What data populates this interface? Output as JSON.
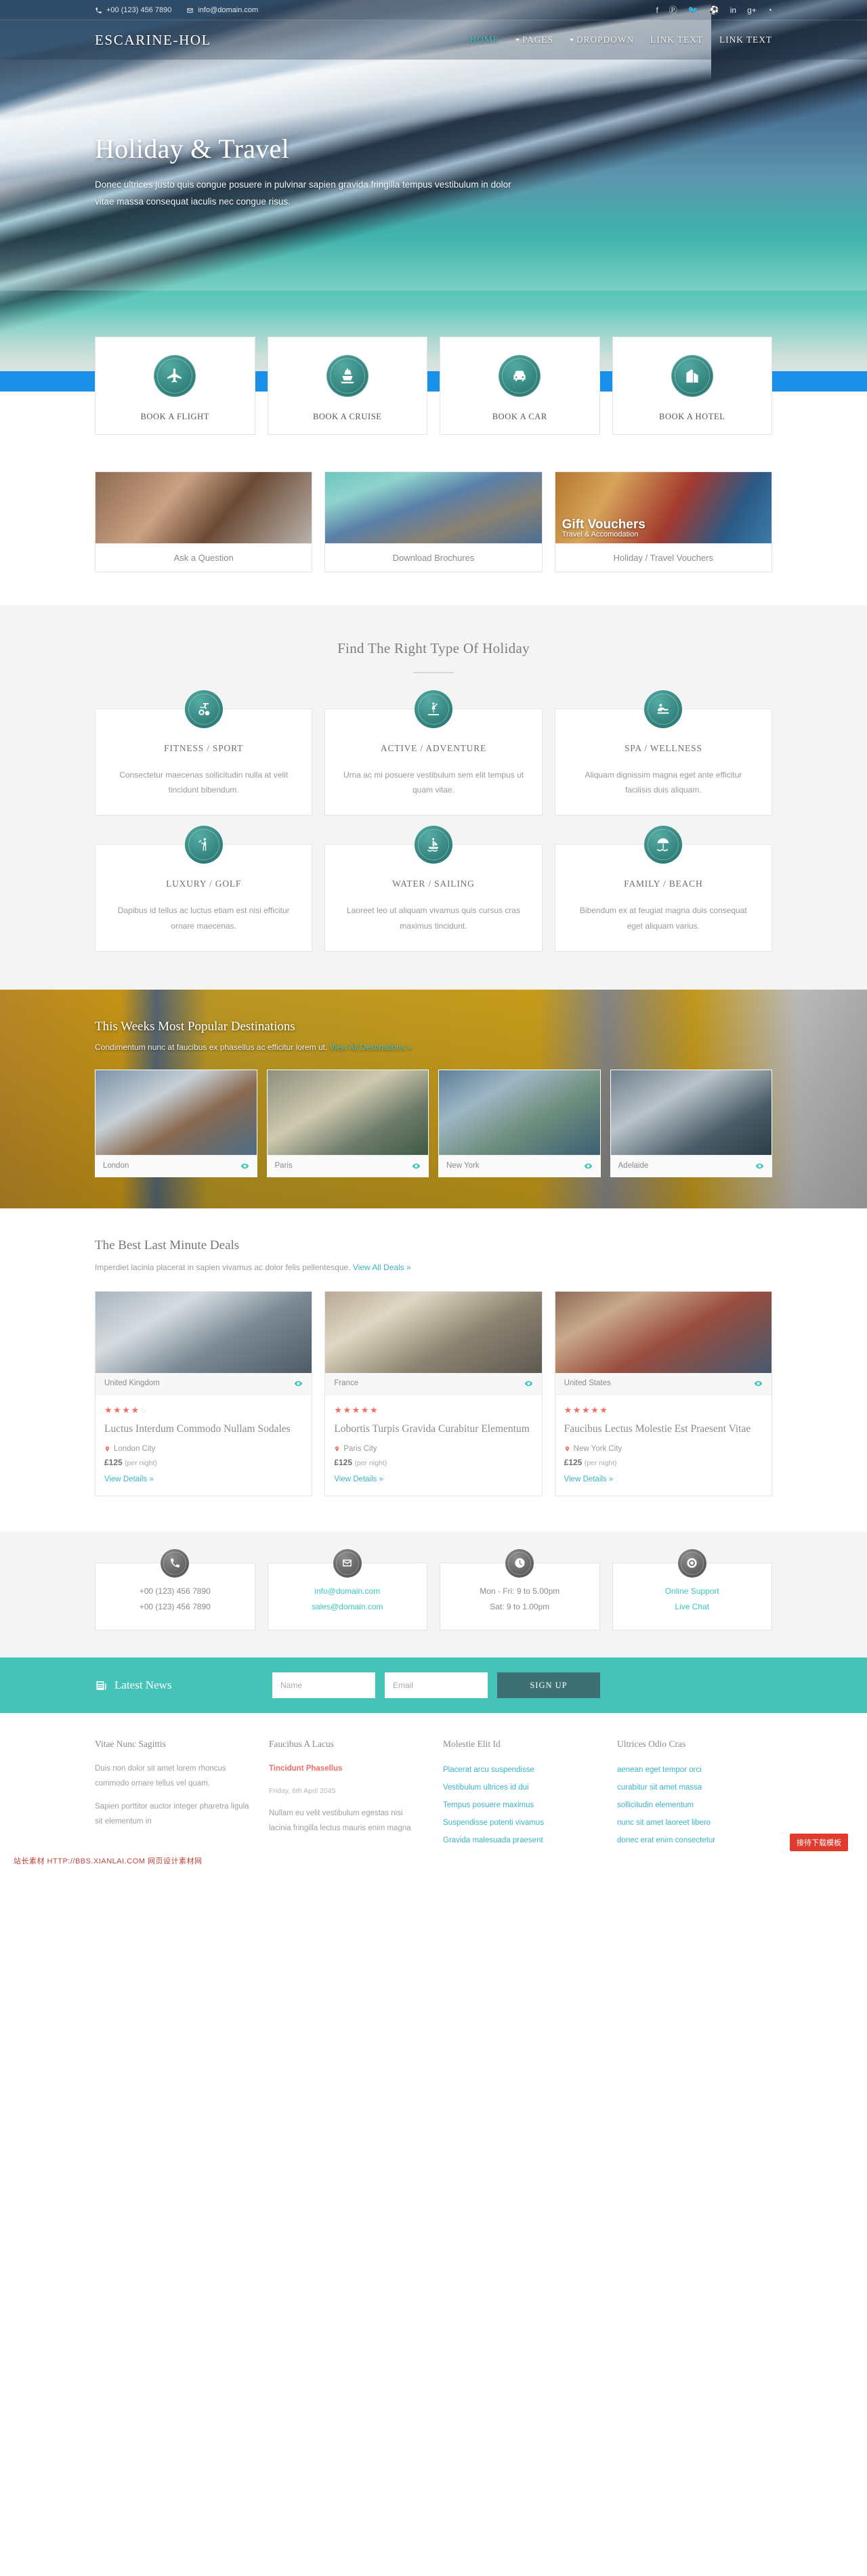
{
  "topbar": {
    "phone": "+00 (123) 456 7890",
    "email": "info@domain.com",
    "socials": [
      {
        "name": "facebook-icon",
        "glyph": "f"
      },
      {
        "name": "pinterest-icon",
        "glyph": "Ⓟ"
      },
      {
        "name": "twitter-icon",
        "glyph": "🐦"
      },
      {
        "name": "dribbble-icon",
        "glyph": "⚽"
      },
      {
        "name": "linkedin-icon",
        "glyph": "in"
      },
      {
        "name": "googleplus-icon",
        "glyph": "g+"
      },
      {
        "name": "rss-icon",
        "glyph": "◔"
      }
    ]
  },
  "header": {
    "logo": "ESCARINE-HOL",
    "nav": [
      {
        "label": "HOME",
        "active": true,
        "dropdown": false
      },
      {
        "label": "PAGES",
        "active": false,
        "dropdown": true
      },
      {
        "label": "DROPDOWN",
        "active": false,
        "dropdown": true
      },
      {
        "label": "LINK TEXT",
        "active": false,
        "dropdown": false
      },
      {
        "label": "LINK TEXT",
        "active": false,
        "dropdown": false
      }
    ]
  },
  "hero": {
    "title": "Holiday & Travel",
    "subtitle": "Donec ultrices justo quis congue posuere in pulvinar sapien gravida fringilla tempus vestibulum in dolor vitae massa consequat iaculis nec congue risus."
  },
  "booking": [
    {
      "label": "BOOK A FLIGHT",
      "icon": "airplane-icon"
    },
    {
      "label": "BOOK A CRUISE",
      "icon": "cruise-ship-icon"
    },
    {
      "label": "BOOK A CAR",
      "icon": "car-icon"
    },
    {
      "label": "BOOK A HOTEL",
      "icon": "hotel-building-icon"
    }
  ],
  "promos": [
    {
      "label": "Ask a Question",
      "caption1": "",
      "caption2": ""
    },
    {
      "label": "Download Brochures",
      "caption1": "",
      "caption2": ""
    },
    {
      "label": "Holiday / Travel Vouchers",
      "caption1": "Gift Vouchers",
      "caption2": "Travel & Accomodation"
    }
  ],
  "types_section": {
    "title": "Find The Right Type Of Holiday",
    "cards": [
      {
        "title": "FITNESS / SPORT",
        "desc": "Consectetur maecenas sollicitudin nulla at velit tincidunt bibendum.",
        "icon": "exercise-bike-icon"
      },
      {
        "title": "ACTIVE / ADVENTURE",
        "desc": "Urna ac mi posuere vestibulum sem elit tempus ut quam vitae.",
        "icon": "paddleboard-icon"
      },
      {
        "title": "SPA / WELLNESS",
        "desc": "Aliquam dignissim magna eget ante efficitur facilisis duis aliquam.",
        "icon": "massage-icon"
      },
      {
        "title": "LUXURY / GOLF",
        "desc": "Dapibus id tellus ac luctus etiam est nisi efficitur ornare maecenas.",
        "icon": "golf-icon"
      },
      {
        "title": "WATER / SAILING",
        "desc": "Laoreet leo ut aliquam vivamus quis cursus cras maximus tincidunt.",
        "icon": "sailing-icon"
      },
      {
        "title": "FAMILY / BEACH",
        "desc": "Bibendum ex at feugiat magna duis consequat eget aliquam varius.",
        "icon": "beach-umbrella-icon"
      }
    ]
  },
  "destinations": {
    "title": "This Weeks Most Popular Destinations",
    "subtitle": "Condimentum nunc at faucibus ex phasellus ac efficitur lorem ut.",
    "link": "View All Destinations »",
    "cards": [
      {
        "name": "London"
      },
      {
        "name": "Paris"
      },
      {
        "name": "New York"
      },
      {
        "name": "Adelaide"
      }
    ]
  },
  "deals": {
    "title": "The Best Last Minute Deals",
    "subtitle": "Imperdiet lacinia placerat in sapien vivamus ac dolor felis pellentesque.",
    "link": "View All Deals »",
    "cards": [
      {
        "country": "United Kingdom",
        "rating": 3.5,
        "name": "Luctus Interdum Commodo Nullam Sodales",
        "city": "London City",
        "price": "£125",
        "per": "(per night)",
        "link": "View Details »"
      },
      {
        "country": "France",
        "rating": 4.5,
        "name": "Lobortis Turpis Gravida Curabitur Elementum",
        "city": "Paris City",
        "price": "£125",
        "per": "(per night)",
        "link": "View Details »"
      },
      {
        "country": "United States",
        "rating": 5,
        "name": "Faucibus Lectus Molestie Est Praesent Vitae",
        "city": "New York City",
        "price": "£125",
        "per": "(per night)",
        "link": "View Details »"
      }
    ]
  },
  "contacts": [
    {
      "icon": "phone-icon",
      "line1": "+00 (123) 456 7890",
      "line2": "+00 (123) 456 7890",
      "link": false
    },
    {
      "icon": "envelope-icon",
      "line1": "info@domain.com",
      "line2": "sales@domain.com",
      "link": true
    },
    {
      "icon": "clock-icon",
      "line1": "Mon - Fri: 9 to 5.00pm",
      "line2": "Sat: 9 to 1.00pm",
      "link": false
    },
    {
      "icon": "support-icon",
      "line1": "Online Support",
      "line2": "Live Chat",
      "link": true
    }
  ],
  "newsletter": {
    "label": "Latest News",
    "name_placeholder": "Name",
    "email_placeholder": "Email",
    "button": "SIGN UP"
  },
  "footer": {
    "columns": [
      {
        "title": "Vitae Nunc Sagittis",
        "paragraphs": [
          "Duis non dolor sit amet lorem rhoncus commodo ornare tellus vel quam.",
          "Sapien porttitor auctor integer pharetra ligula sit elementum in"
        ],
        "links": []
      },
      {
        "title": "Faucibus A Lacus",
        "highlight": "Tincidunt Phasellus",
        "date": "Friday, 6th April 2045",
        "paragraphs": [
          "Nullam eu velit vestibulum egestas nisi lacinia fringilla lectus mauris enim magna"
        ],
        "links": []
      },
      {
        "title": "Molestie Elit Id",
        "paragraphs": [],
        "links": [
          "Placerat arcu suspendisse",
          "Vestibulum ultrices id dui",
          "Tempus posuere maximus",
          "Suspendisse potenti vivamus",
          "Gravida malesuada praesent"
        ]
      },
      {
        "title": "Ultrices Odio Cras",
        "paragraphs": [],
        "links": [
          "aenean eget tempor orci",
          "curabitur sit amet massa",
          "sollicitudin elementum",
          "nunc sit amet laoreet libero",
          "donec erat enim consectetur"
        ]
      }
    ],
    "badge": "接待下载模板",
    "watermark": "站长素材 HTTP://BBS.XIANLAI.COM 网页设计素材网"
  },
  "colors": {
    "teal": "#3cc6bd",
    "teal_dark": "#2f7e79",
    "coral": "#ef6f62",
    "newsletter_bg": "#46c3b8",
    "signup_bg": "#3d6f73"
  }
}
